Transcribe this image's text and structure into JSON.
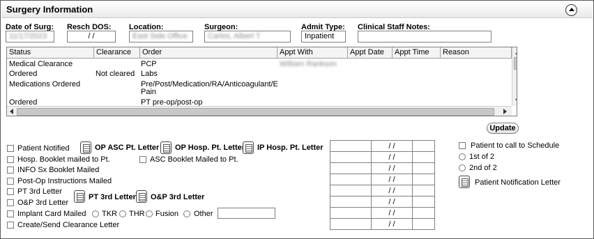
{
  "header": {
    "title": "Surgery Information",
    "collapse_icon": "collapse-up-icon"
  },
  "fields": {
    "date_of_surg": {
      "label": "Date of Surg:",
      "value": "11/17/2023"
    },
    "resch_dos": {
      "label": "Resch DOS:",
      "value": " / /"
    },
    "location": {
      "label": "Location:",
      "value": "East Side Office"
    },
    "surgeon": {
      "label": "Surgeon:",
      "value": "Carlos, Albert T"
    },
    "admit_type": {
      "label": "Admit Type:",
      "value": "Inpatient"
    },
    "staff_notes": {
      "label": "Clinical Staff Notes:",
      "value": ""
    }
  },
  "grid": {
    "columns": [
      "Status",
      "Clearance",
      "Order",
      "Appt With",
      "Appt Date",
      "Appt Time",
      "Reason"
    ],
    "rows": [
      {
        "status": "Medical Clearance",
        "clearance": "",
        "order": "PCP",
        "order2": "",
        "appt_with": "William Rankson"
      },
      {
        "status": "Ordered",
        "clearance": "Not cleared",
        "order": "Labs",
        "order2": "",
        "appt_with": ""
      },
      {
        "status": "Medications Ordered",
        "clearance": "",
        "order": "Pre/Post/Medication/RA/Anticoagulant/E",
        "order2": "Pain",
        "appt_with": ""
      },
      {
        "status": "Ordered",
        "clearance": "",
        "order": "PT pre-op/post-op",
        "order2": "",
        "appt_with": ""
      }
    ]
  },
  "update_button": "Update",
  "checklist": {
    "patient_notified": "Patient Notified",
    "hosp_booklet": "Hosp. Booklet mailed to Pt.",
    "info_sx_booklet": "INFO Sx Booklet Mailed",
    "post_op": "Post-Op Instructions Mailed",
    "pt_3rd": "PT 3rd Letter",
    "op_3rd": "O&P 3rd Letter",
    "implant_card": "Implant Card Mailed",
    "create_clearance": "Create/Send Clearance Letter",
    "asc_booklet": "ASC Booklet Mailed to Pt."
  },
  "implant_options": [
    "TKR",
    "THR",
    "Fusion",
    "Other"
  ],
  "letters": {
    "op_asc": "OP ASC Pt. Letter",
    "op_hosp": "OP Hosp. Pt. Letter",
    "ip_hosp": "IP Hosp. Pt. Letter",
    "pt_3rd": "PT 3rd Letter",
    "op_3rd": "O&P 3rd Letter"
  },
  "date_table": {
    "rows": [
      " / /",
      " / /",
      " / /",
      " / /",
      " / /",
      " / /",
      " / /",
      " / /"
    ]
  },
  "right_panel": {
    "call_to_schedule": "Patient to call to Schedule",
    "first_of_2": "1st of 2",
    "second_of_2": "2nd of 2",
    "notification_letter": "Patient Notification Letter"
  }
}
